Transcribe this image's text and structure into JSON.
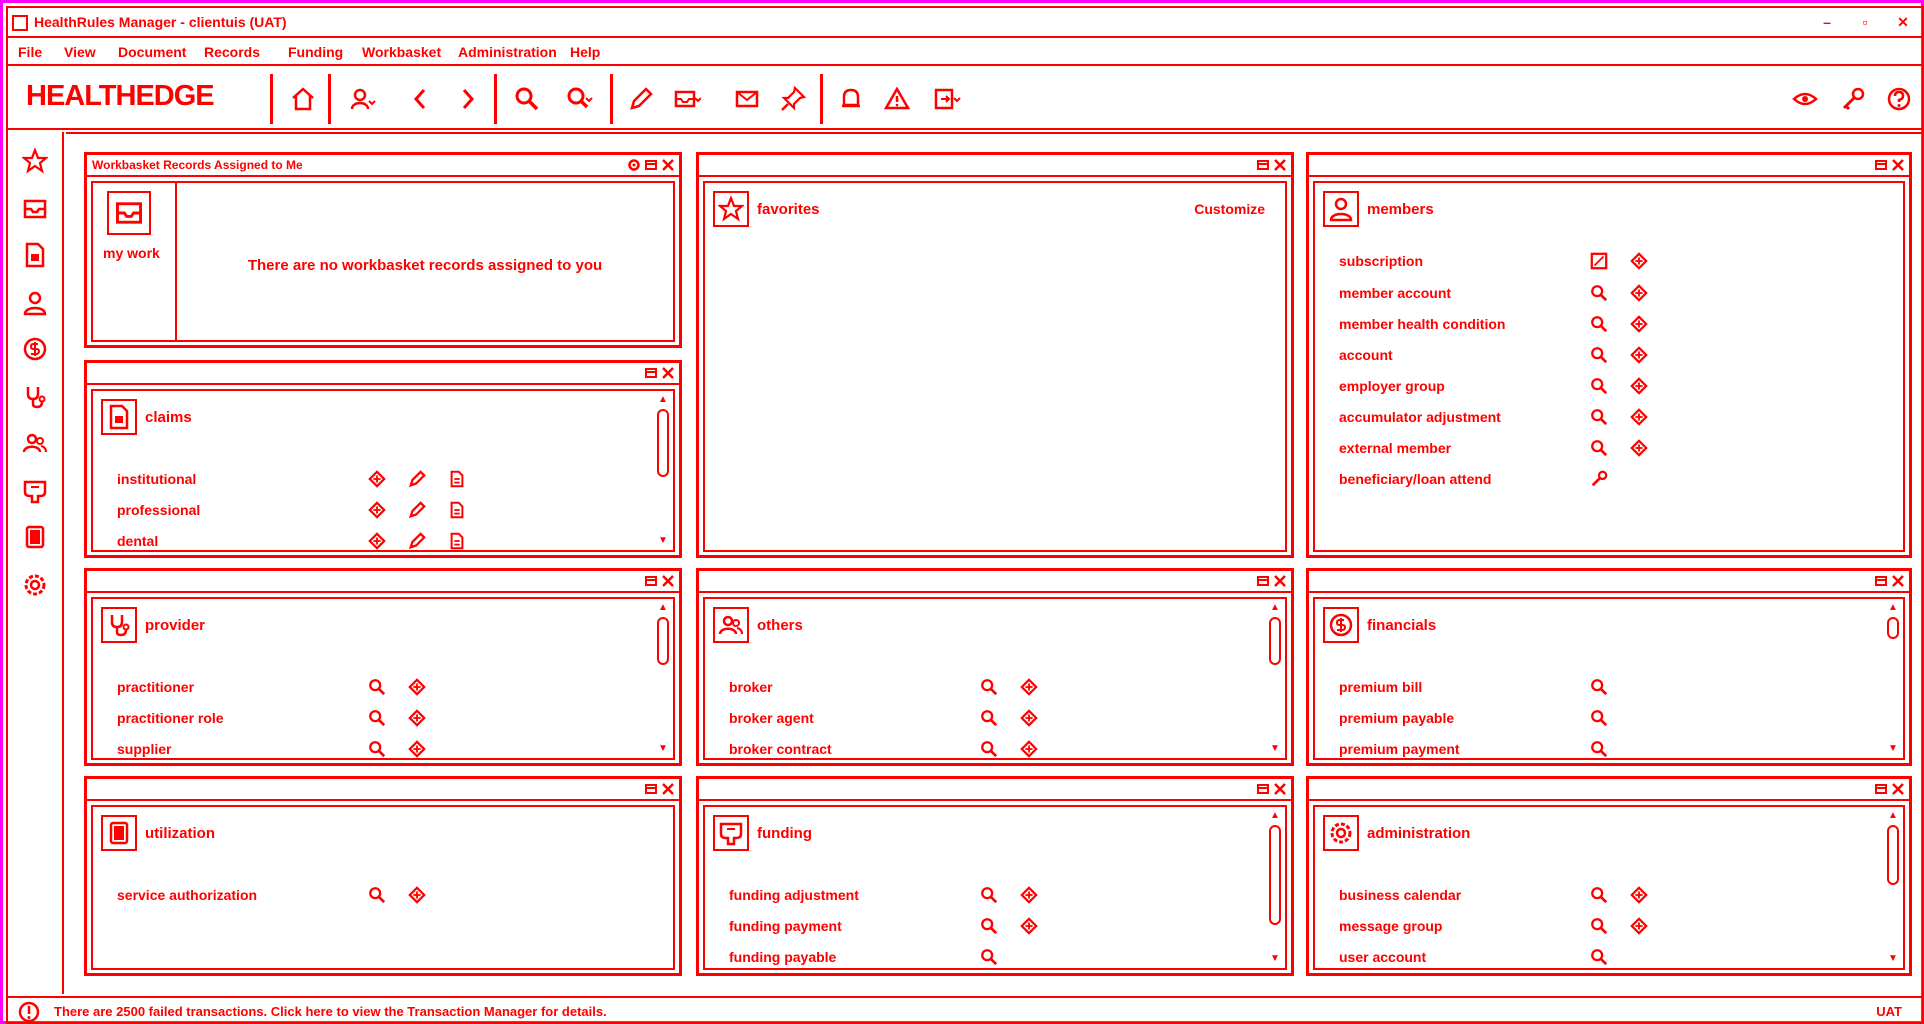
{
  "window": {
    "title": "HealthRules Manager - clientuis   (UAT)",
    "controls": [
      "–",
      "▫",
      "✕"
    ]
  },
  "menu": [
    "File",
    "View",
    "Document",
    "Records",
    "Funding",
    "Workbasket",
    "Administration",
    "Help"
  ],
  "logo": "HEALTHEDGE",
  "toolbar": {
    "buttons": [
      "home-icon",
      "users-icon",
      "back-icon",
      "forward-icon",
      "search-icon",
      "search-more-icon",
      "edit-icon",
      "inbox-icon",
      "mail-icon",
      "pin-icon",
      "bell-icon",
      "warning-icon",
      "export-icon"
    ],
    "right_buttons": [
      "eye-icon",
      "key-icon",
      "help-icon"
    ]
  },
  "sidenav": [
    "star-icon",
    "inbox-icon",
    "document-icon",
    "person-icon",
    "dollar-icon",
    "stethoscope-icon",
    "group-icon",
    "funding-icon",
    "book-icon",
    "gear-icon"
  ],
  "panels": {
    "workbasket": {
      "title": "Workbasket Records Assigned to Me",
      "label": "my work",
      "message": "There are no workbasket records assigned to you"
    },
    "favorites": {
      "title": "favorites",
      "action": "Customize"
    },
    "members": {
      "title": "members",
      "items": [
        "subscription",
        "member account",
        "member health condition",
        "account",
        "employer group",
        "accumulator adjustment",
        "external member",
        "beneficiary/loan attend"
      ]
    },
    "claims": {
      "title": "claims",
      "items": [
        "institutional",
        "professional",
        "dental"
      ]
    },
    "provider": {
      "title": "provider",
      "items": [
        "practitioner",
        "practitioner role",
        "supplier"
      ]
    },
    "others": {
      "title": "others",
      "items": [
        "broker",
        "broker agent",
        "broker contract"
      ]
    },
    "financials": {
      "title": "financials",
      "items": [
        "premium bill",
        "premium payable",
        "premium payment"
      ]
    },
    "utilization": {
      "title": "utilization",
      "items": [
        "service authorization"
      ]
    },
    "funding": {
      "title": "funding",
      "items": [
        "funding adjustment",
        "funding payment",
        "funding payable"
      ]
    },
    "administration": {
      "title": "administration",
      "items": [
        "business calendar",
        "message group",
        "user account"
      ]
    }
  },
  "status": {
    "message": "There are 2500 failed transactions. Click here to view the Transaction Manager for details.",
    "env": "UAT"
  },
  "colors": {
    "accent": "#ff0000",
    "frame": "#ff00ff",
    "background": "#ffffff"
  }
}
